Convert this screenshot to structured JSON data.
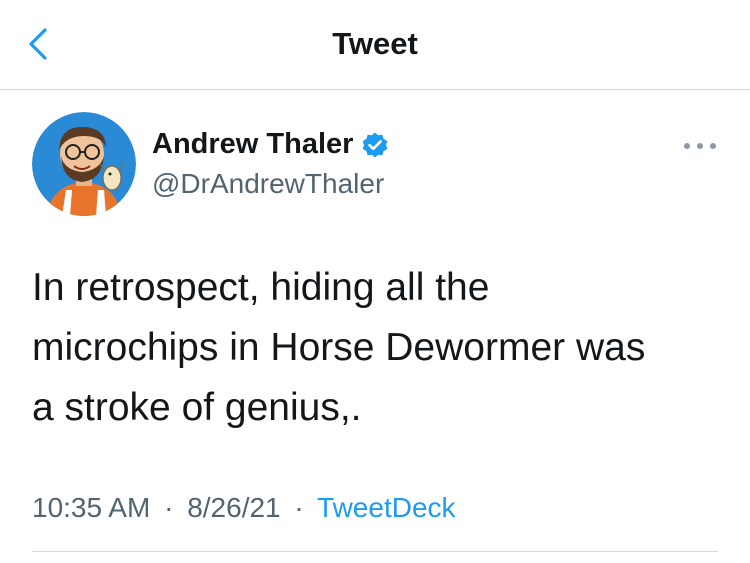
{
  "header": {
    "title": "Tweet",
    "back_icon": "chevron-left-icon"
  },
  "author": {
    "name": "Andrew Thaler",
    "handle": "@DrAndrewThaler",
    "verified": true,
    "avatar_icon": "avatar-cartoon"
  },
  "tweet": {
    "text": "In retrospect, hiding all the\nmicrochips in Horse Dewormer was\na stroke of genius,.",
    "time": "10:35 AM",
    "separator": "·",
    "date": "8/26/21",
    "source": "TweetDeck"
  },
  "colors": {
    "accent": "#1d9bf0",
    "text": "#14171a",
    "secondary": "#536471",
    "divider": "#d6d9dc"
  }
}
